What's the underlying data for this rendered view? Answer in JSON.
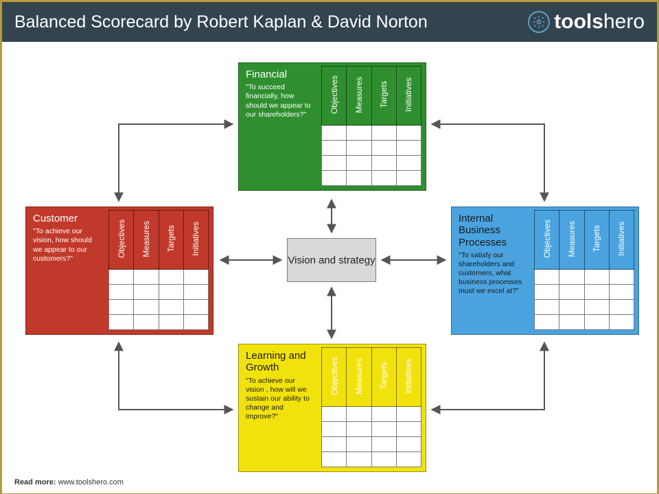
{
  "header": {
    "title": "Balanced Scorecard by Robert Kaplan & David Norton",
    "brand_bold": "tools",
    "brand_thin": "hero"
  },
  "hub": {
    "label": "Vision and strategy"
  },
  "columns": [
    "Objectives",
    "Measures",
    "Targets",
    "Initiatives"
  ],
  "cards": {
    "financial": {
      "title": "Financial",
      "question": "\"To succeed financially, how should we appear to our shareholders?\""
    },
    "customer": {
      "title": "Customer",
      "question": "\"To achieve our vision, how should we appear to our customers?\""
    },
    "ibp": {
      "title": "Internal Business Processes",
      "question": "\"To satisfy our shareholders and customers, what business processes must we excel at?\""
    },
    "learning": {
      "title": "Learning and Growth",
      "question": "\"To achieve our vision , how will we sustain our ability to change and improve?\""
    }
  },
  "footer": {
    "label": "Read more:",
    "url": "www.toolshero.com"
  }
}
